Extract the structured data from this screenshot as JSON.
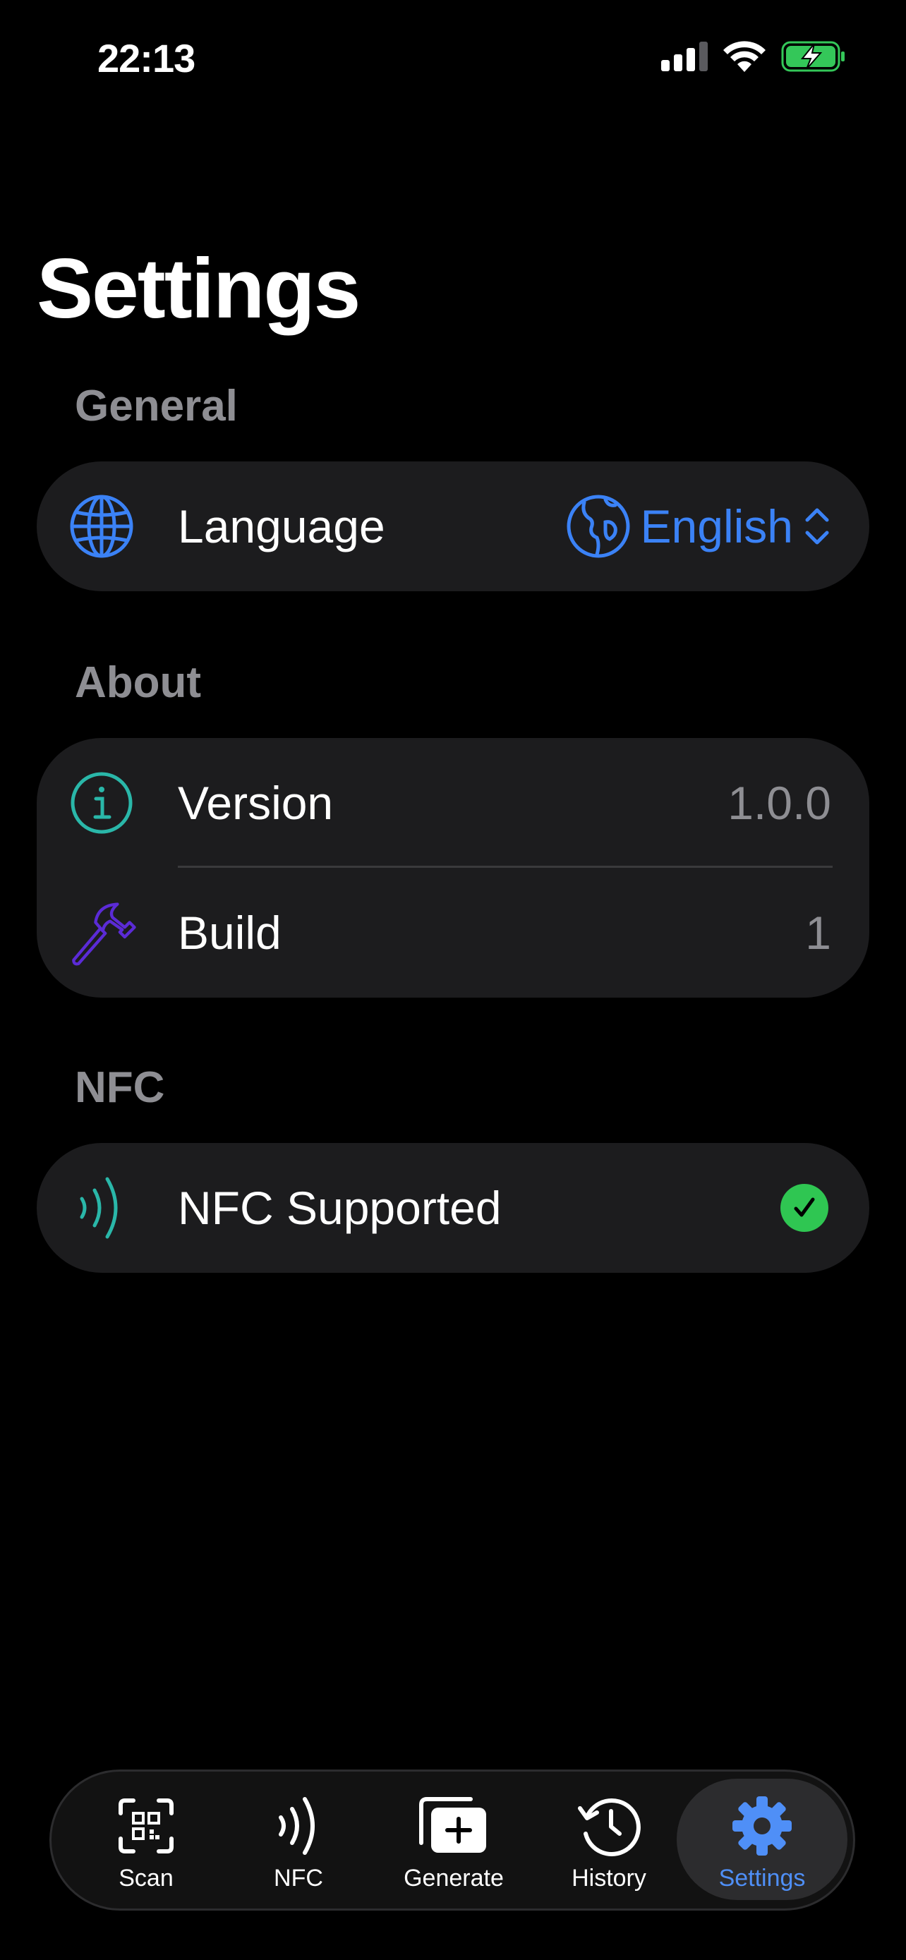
{
  "status_bar": {
    "time": "22:13",
    "signal_icon": "cellular-signal-icon",
    "wifi_icon": "wifi-icon",
    "battery_icon": "battery-charging-icon",
    "battery_color": "#34c759"
  },
  "page": {
    "title": "Settings"
  },
  "sections": {
    "general": {
      "header": "General",
      "language": {
        "label": "Language",
        "value": "English",
        "icon": "globe-icon",
        "picker_icon": "globe-americas-icon",
        "accent": "#3b82f6"
      }
    },
    "about": {
      "header": "About",
      "version": {
        "label": "Version",
        "value": "1.0.0",
        "icon": "info-circle-icon",
        "icon_color": "#2ab7a9"
      },
      "build": {
        "label": "Build",
        "value": "1",
        "icon": "hammer-icon",
        "icon_color": "#5b2bd6"
      }
    },
    "nfc": {
      "header": "NFC",
      "supported": {
        "label": "NFC Supported",
        "icon": "nfc-waves-icon",
        "status_icon": "checkmark-circle-icon",
        "status_color": "#2fc652"
      }
    }
  },
  "tab_bar": {
    "active_color": "#4f8ff7",
    "tabs": [
      {
        "label": "Scan",
        "icon": "qr-scan-icon"
      },
      {
        "label": "NFC",
        "icon": "nfc-icon"
      },
      {
        "label": "Generate",
        "icon": "generate-plus-icon"
      },
      {
        "label": "History",
        "icon": "history-clock-icon"
      },
      {
        "label": "Settings",
        "icon": "gear-icon",
        "active": true
      }
    ]
  }
}
